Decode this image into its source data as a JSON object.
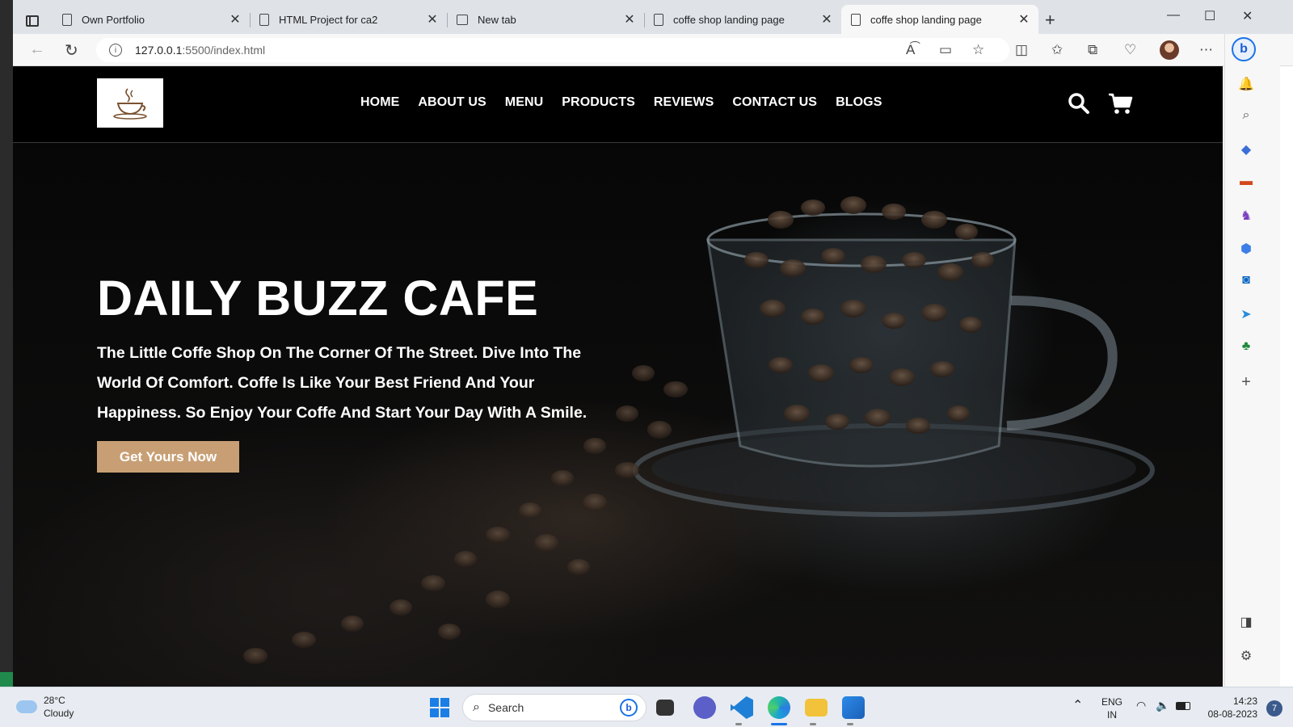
{
  "browser": {
    "tabs": [
      {
        "title": "Own Portfolio",
        "type": "page",
        "active": false
      },
      {
        "title": "HTML Project for ca2",
        "type": "page",
        "active": false
      },
      {
        "title": "New tab",
        "type": "newtab",
        "active": false
      },
      {
        "title": "coffe shop landing page",
        "type": "page",
        "active": false
      },
      {
        "title": "coffe shop landing page",
        "type": "page",
        "active": true
      }
    ],
    "url_host": "127.0.0.1",
    "url_rest": ":5500/index.html"
  },
  "site": {
    "nav": [
      "HOME",
      "ABOUT US",
      "MENU",
      "PRODUCTS",
      "REVIEWS",
      "CONTACT US",
      "BLOGS"
    ],
    "hero": {
      "title": "DAILY BUZZ CAFE",
      "text": "The Little Coffe Shop On The Corner Of The Street. Dive Into The World Of Comfort. Coffe Is Like Your Best Friend And Your Happiness. So Enjoy Your Coffe And Start Your Day With A Smile.",
      "button": "Get Yours Now"
    },
    "accent_color": "#c89f74"
  },
  "taskbar": {
    "weather_temp": "28°C",
    "weather_desc": "Cloudy",
    "search_placeholder": "Search",
    "lang_1": "ENG",
    "lang_2": "IN",
    "time": "14:23",
    "date": "08-08-2023",
    "notification_count": "7"
  }
}
